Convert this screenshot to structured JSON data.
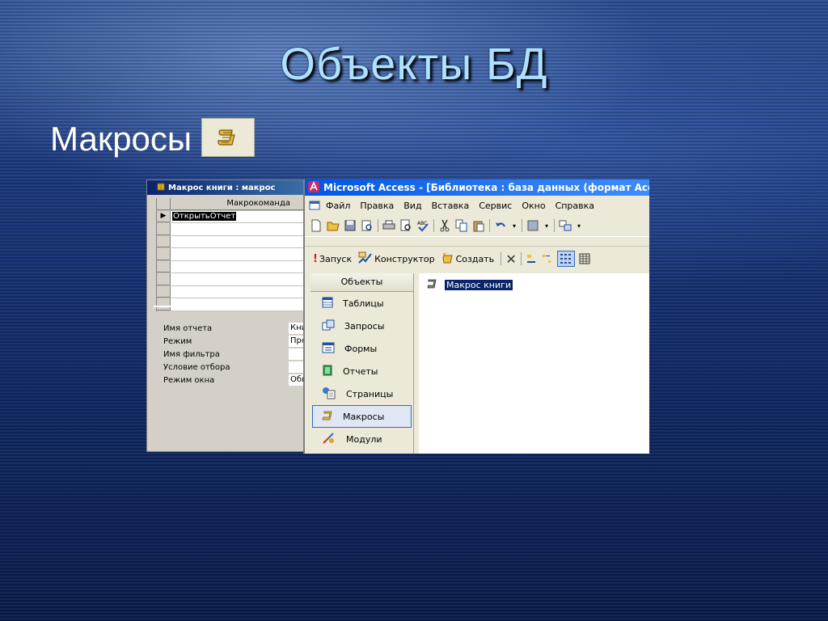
{
  "slide": {
    "title": "Объекты БД",
    "subtitle": "Макросы"
  },
  "macro_window": {
    "title": "Макрос книги : макрос",
    "column_header": "Макрокоманда",
    "rows": [
      "ОткрытьОтчет",
      "",
      "",
      "",
      "",
      "",
      "",
      ""
    ],
    "args": [
      {
        "label": "Имя отчета",
        "value": "Кни"
      },
      {
        "label": "Режим",
        "value": "Про"
      },
      {
        "label": "Имя фильтра",
        "value": ""
      },
      {
        "label": "Условие отбора",
        "value": ""
      },
      {
        "label": "Режим окна",
        "value": "Обы"
      }
    ]
  },
  "access_window": {
    "title": "Microsoft Access - [Библиотека : база данных (формат Access",
    "menu": [
      "Файл",
      "Правка",
      "Вид",
      "Вставка",
      "Сервис",
      "Окно",
      "Справка"
    ],
    "db_toolbar": {
      "run": "Запуск",
      "design": "Конструктор",
      "create": "Создать"
    },
    "objects_header": "Объекты",
    "objects": [
      {
        "label": "Таблицы",
        "icon": "table-icon"
      },
      {
        "label": "Запросы",
        "icon": "query-icon"
      },
      {
        "label": "Формы",
        "icon": "form-icon"
      },
      {
        "label": "Отчеты",
        "icon": "report-icon"
      },
      {
        "label": "Страницы",
        "icon": "page-icon"
      },
      {
        "label": "Макросы",
        "icon": "macro-icon",
        "active": true
      },
      {
        "label": "Модули",
        "icon": "module-icon"
      }
    ],
    "list_item": "Макрос книги"
  },
  "colors": {
    "title_text": "#aee0ff",
    "xp_titlebar": "#0054e3",
    "selection": "#0a246a"
  }
}
